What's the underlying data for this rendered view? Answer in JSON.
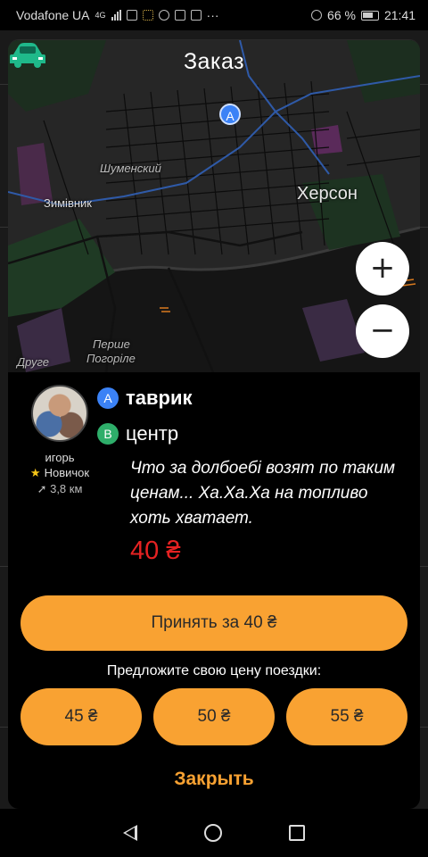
{
  "status_bar": {
    "carrier": "Vodafone UA",
    "network": "4G",
    "battery": "66 %",
    "time": "21:41"
  },
  "dialog": {
    "title": "Заказ",
    "map": {
      "labels": {
        "city_main": "Херсон",
        "district_1": "Шуменский",
        "district_2": "Зимівник",
        "district_3": "Перше",
        "district_3b": "Погоріле",
        "district_4": "Друге"
      },
      "marker_a": "A",
      "zoom_in": "+",
      "zoom_out": "−"
    },
    "driver": {
      "name": "игорь",
      "rank": "Новичок",
      "distance": "3,8 км"
    },
    "route": {
      "from_pin": "A",
      "from": "таврик",
      "to_pin": "B",
      "to": "центр"
    },
    "comment": "Что за долбоебі возят по таким ценам... Ха.Ха.Ха на топливо хоть хватает.",
    "price": "40 ₴",
    "accept_label": "Принять за 40 ₴",
    "offer_prompt": "Предложите свою цену поездки:",
    "offers": [
      "45 ₴",
      "50 ₴",
      "55 ₴"
    ],
    "close_label": "Закрыть"
  },
  "colors": {
    "accent": "#f9a232",
    "price": "#e52222",
    "pin_a": "#3b82f6",
    "pin_b": "#2eae6a"
  },
  "icons": [
    "signal-icon",
    "wifi-icon",
    "notification-icon",
    "location-icon",
    "battery-icon",
    "car-icon",
    "star-icon",
    "navigation-arrow-icon",
    "back-icon",
    "home-icon",
    "recents-icon"
  ]
}
